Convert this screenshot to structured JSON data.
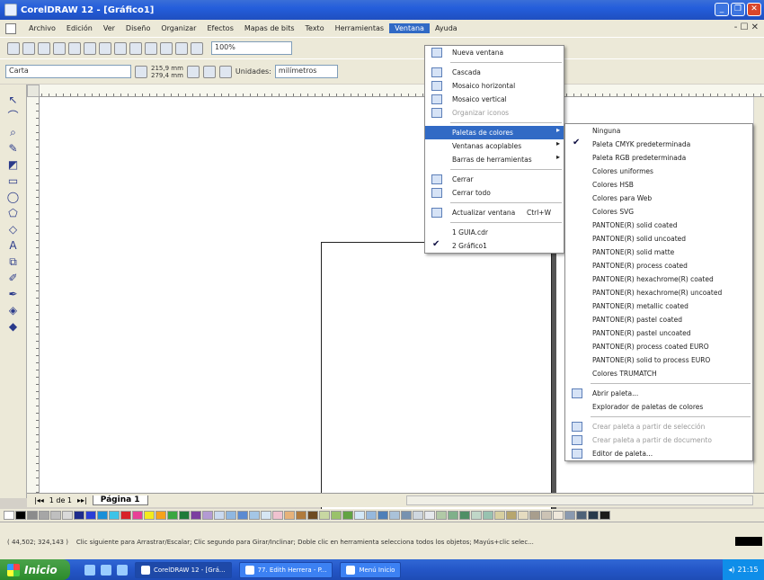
{
  "window": {
    "title": "CorelDRAW 12 - [Gráfico1]"
  },
  "window_controls": {
    "minimize": "_",
    "restore": "❐",
    "close": "✕",
    "mdi": "- ☐ ✕"
  },
  "menubar": {
    "items": [
      "Archivo",
      "Edición",
      "Ver",
      "Diseño",
      "Organizar",
      "Efectos",
      "Mapas de bits",
      "Texto",
      "Herramientas",
      "Ventana",
      "Ayuda"
    ],
    "active_index": 9
  },
  "toolbar": {
    "zoom_value": "100%",
    "paper_type": "Carta",
    "width_value": "215,9 mm",
    "height_value": "279,4 mm",
    "units_label": "Unidades:",
    "units_value": "milímetros"
  },
  "window_menu": {
    "items": [
      {
        "label": "Nueva ventana",
        "icon": "new-window-icon",
        "enabled": true
      },
      {
        "sep": true
      },
      {
        "label": "Cascada",
        "icon": "cascade-icon",
        "enabled": true
      },
      {
        "label": "Mosaico horizontal",
        "icon": "tile-horizontal-icon",
        "enabled": true
      },
      {
        "label": "Mosaico vertical",
        "icon": "tile-vertical-icon",
        "enabled": true
      },
      {
        "label": "Organizar iconos",
        "icon": "arrange-icons-icon",
        "enabled": false
      },
      {
        "sep": true
      },
      {
        "label": "Paletas de colores",
        "submenu": true,
        "highlighted": true,
        "enabled": true
      },
      {
        "label": "Ventanas acoplables",
        "submenu": true,
        "enabled": true
      },
      {
        "label": "Barras de herramientas",
        "submenu": true,
        "enabled": true
      },
      {
        "sep": true
      },
      {
        "label": "Cerrar",
        "icon": "close-doc-icon",
        "enabled": true
      },
      {
        "label": "Cerrar todo",
        "icon": "close-all-icon",
        "enabled": true
      },
      {
        "sep": true
      },
      {
        "label": "Actualizar ventana",
        "icon": "refresh-icon",
        "shortcut": "Ctrl+W",
        "enabled": true
      },
      {
        "sep": true
      },
      {
        "label": "1 GUIA.cdr",
        "enabled": true
      },
      {
        "label": "2 Gráfico1",
        "checked": true,
        "enabled": true
      }
    ]
  },
  "palette_submenu": {
    "items": [
      {
        "label": "Ninguna"
      },
      {
        "label": "Paleta CMYK predeterminada",
        "checked": true
      },
      {
        "label": "Paleta RGB predeterminada"
      },
      {
        "label": "Colores uniformes"
      },
      {
        "label": "Colores HSB"
      },
      {
        "label": "Colores para Web"
      },
      {
        "label": "Colores SVG"
      },
      {
        "label": "PANTONE(R) solid coated"
      },
      {
        "label": "PANTONE(R) solid uncoated"
      },
      {
        "label": "PANTONE(R) solid matte"
      },
      {
        "label": "PANTONE(R) process coated"
      },
      {
        "label": "PANTONE(R) hexachrome(R) coated"
      },
      {
        "label": "PANTONE(R) hexachrome(R) uncoated"
      },
      {
        "label": "PANTONE(R) metallic coated"
      },
      {
        "label": "PANTONE(R) pastel coated"
      },
      {
        "label": "PANTONE(R) pastel uncoated"
      },
      {
        "label": "PANTONE(R) process coated EURO"
      },
      {
        "label": "PANTONE(R) solid to process EURO"
      },
      {
        "label": "Colores TRUMATCH"
      },
      {
        "sep": true
      },
      {
        "label": "Abrir paleta...",
        "icon": "open-palette-icon"
      },
      {
        "label": "Explorador de paletas de colores"
      },
      {
        "sep": true
      },
      {
        "label": "Crear paleta a partir de selección",
        "icon": "create-from-selection-icon",
        "disabled": true
      },
      {
        "label": "Crear paleta a partir de documento",
        "icon": "create-from-document-icon",
        "disabled": true
      },
      {
        "label": "Editor de paleta...",
        "icon": "palette-editor-icon"
      }
    ]
  },
  "page_nav": {
    "page_count": "1 de 1",
    "tab_label": "Página 1"
  },
  "palette_colors": [
    "#ffffff",
    "#000000",
    "#8c8c8c",
    "#a6a6a6",
    "#bfbfbf",
    "#d9d9d9",
    "#1e2c8c",
    "#2b3fd6",
    "#1a8fd8",
    "#3cc3e8",
    "#d8232a",
    "#e83f96",
    "#f3ea1e",
    "#f7a21b",
    "#3aa641",
    "#1f7a3a",
    "#7b3fa0",
    "#b39ad3",
    "#c9d9ef",
    "#8fb7e0",
    "#5b8ad1",
    "#a4c6e6",
    "#d6e6f4",
    "#f0c2cf",
    "#e6b27a",
    "#b07a3c",
    "#6e4a23",
    "#c8d8a2",
    "#9ac26a",
    "#62a344",
    "#d3e8f7",
    "#96b8dc",
    "#4f7fb8",
    "#aac2d9",
    "#7792b0",
    "#cfd7df",
    "#e5e8ec",
    "#b1c9a6",
    "#80b08a",
    "#4f8f66",
    "#c0d7c8",
    "#98c2b0",
    "#d7cfa0",
    "#b7a66e",
    "#e5dcc0",
    "#a89e8d",
    "#ccc3b5",
    "#efe8db",
    "#8a9ab0",
    "#4e6278",
    "#28394c",
    "#1a1a1a"
  ],
  "status": {
    "coords": "( 44,502; 324,143 )",
    "hint": "Clic siguiente para Arrastrar/Escalar; Clic segundo para Girar/Inclinar; Doble clic en herramienta selecciona todos los objetos; Mayús+clic selec..."
  },
  "taskbar": {
    "start_label": "Inicio",
    "tasks": [
      "CorelDRAW 12 - [Grá...",
      "77. Edith Herrera - P...",
      "Menú Inicio"
    ],
    "clock": "21:15"
  }
}
